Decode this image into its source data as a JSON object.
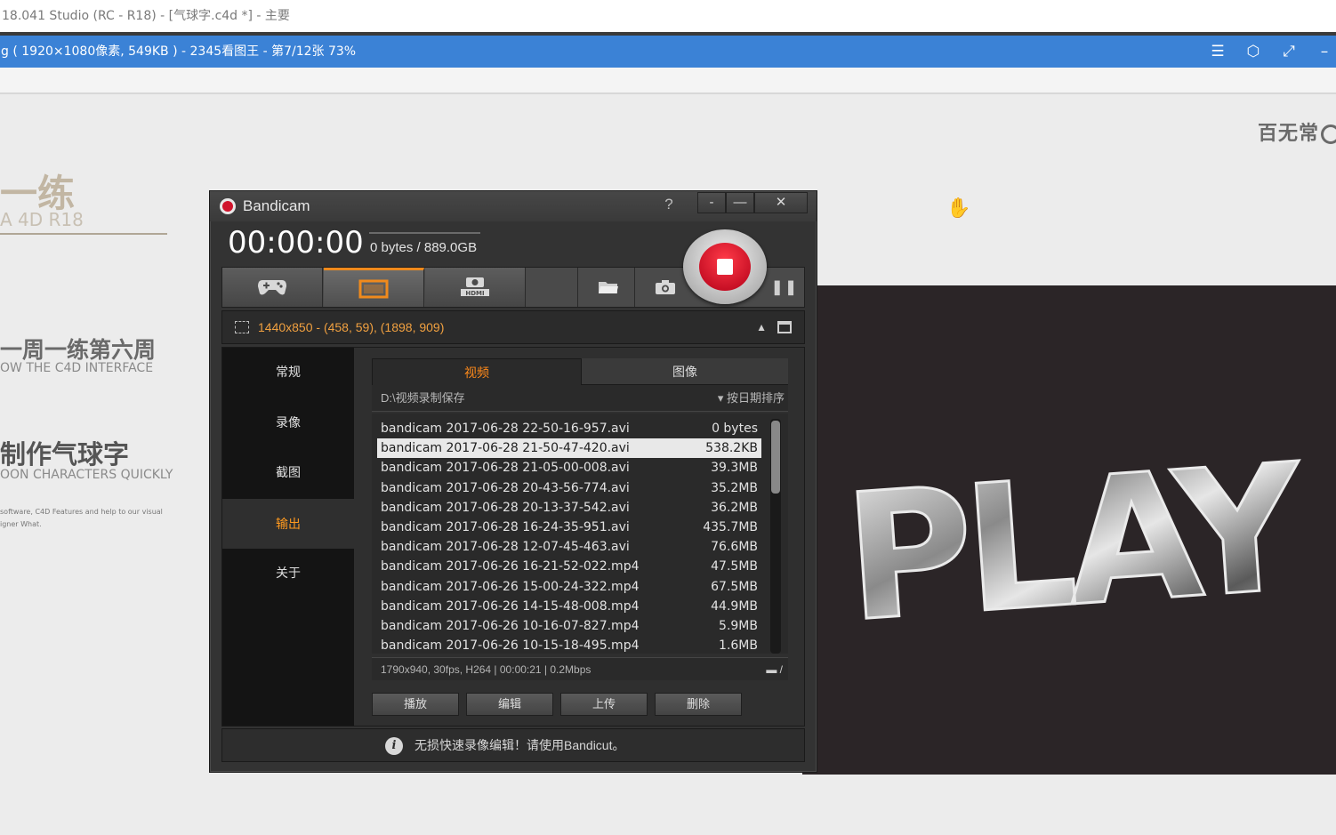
{
  "c4d_titlebar": {
    "title": "18.041 Studio (RC - R18) - [气球字.c4d *] - 主要"
  },
  "viewer": {
    "title": "g ( 1920×1080像素, 549KB ) - 2345看图王 - 第7/12张 73%",
    "controls": {
      "menu": "☰",
      "skin": "⬡",
      "fullscreen": "⤢",
      "minimize": "–"
    }
  },
  "slide": {
    "brand": "百无常",
    "heading1": "一练",
    "heading1_sub": "A 4D R18",
    "heading2": "一周一练第六周",
    "heading2_sub": "OW THE C4D INTERFACE",
    "heading3": "制作气球字",
    "heading3_sub": "OON CHARACTERS QUICKLY",
    "description": "software, C4D Features and help to our visual igner What.",
    "image_text": "PLAY"
  },
  "bandicam": {
    "title": "Bandicam",
    "help": "?",
    "window_buttons": {
      "minimize_tray": "-",
      "minimize": "—",
      "close": "✕"
    },
    "timer": "00:00:00",
    "size": "0 bytes / 889.0GB",
    "mode_tabs": [
      {
        "name": "game-mode",
        "icon": "gamepad-icon"
      },
      {
        "name": "screen-mode",
        "icon": "screen-rectangle-icon"
      },
      {
        "name": "device-mode",
        "icon": "hdmi-icon",
        "label": "HDMI"
      }
    ],
    "region": "1440x850 - (458, 59), (1898, 909)",
    "sidebar": [
      "常规",
      "录像",
      "截图",
      "输出",
      "关于"
    ],
    "sidebar_active": "输出",
    "tabs": {
      "video": "视频",
      "image": "图像"
    },
    "path": "D:\\视频录制保存",
    "sort": "按日期排序",
    "files": [
      {
        "name": "bandicam 2017-06-28 22-50-16-957.avi",
        "size": "0 bytes"
      },
      {
        "name": "bandicam 2017-06-28 21-50-47-420.avi",
        "size": "538.2KB",
        "selected": true
      },
      {
        "name": "bandicam 2017-06-28 21-05-00-008.avi",
        "size": "39.3MB"
      },
      {
        "name": "bandicam 2017-06-28 20-43-56-774.avi",
        "size": "35.2MB"
      },
      {
        "name": "bandicam 2017-06-28 20-13-37-542.avi",
        "size": "36.2MB"
      },
      {
        "name": "bandicam 2017-06-28 16-24-35-951.avi",
        "size": "435.7MB"
      },
      {
        "name": "bandicam 2017-06-28 12-07-45-463.avi",
        "size": "76.6MB"
      },
      {
        "name": "bandicam 2017-06-26 16-21-52-022.mp4",
        "size": "47.5MB"
      },
      {
        "name": "bandicam 2017-06-26 15-00-24-322.mp4",
        "size": "67.5MB"
      },
      {
        "name": "bandicam 2017-06-26 14-15-48-008.mp4",
        "size": "44.9MB"
      },
      {
        "name": "bandicam 2017-06-26 10-16-07-827.mp4",
        "size": "5.9MB"
      },
      {
        "name": "bandicam 2017-06-26 10-15-18-495.mp4",
        "size": "1.6MB"
      }
    ],
    "file_info": "1790x940, 30fps, H264 | 00:00:21 | 0.2Mbps",
    "buttons": {
      "play": "播放",
      "edit": "编辑",
      "upload": "上传",
      "delete": "删除"
    },
    "footer": "无损快速录像编辑！请使用Bandicut。",
    "colors": {
      "accent": "#f08a1c",
      "record": "#d0142c"
    }
  }
}
